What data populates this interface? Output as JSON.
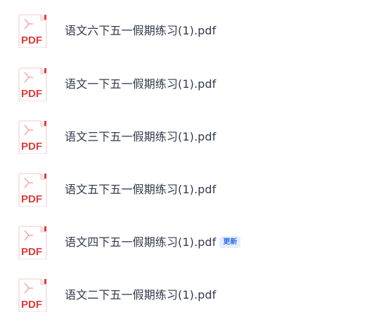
{
  "files": [
    {
      "name": "语文六下五一假期练习(1).pdf",
      "icon": "pdf-file-icon",
      "icon_text": "PDF",
      "badge": ""
    },
    {
      "name": "语文一下五一假期练习(1).pdf",
      "icon": "pdf-file-icon",
      "icon_text": "PDF",
      "badge": ""
    },
    {
      "name": "语文三下五一假期练习(1).pdf",
      "icon": "pdf-file-icon",
      "icon_text": "PDF",
      "badge": ""
    },
    {
      "name": "语文五下五一假期练习(1).pdf",
      "icon": "pdf-file-icon",
      "icon_text": "PDF",
      "badge": ""
    },
    {
      "name": "语文四下五一假期练习(1).pdf",
      "icon": "pdf-file-icon",
      "icon_text": "PDF",
      "badge": "更新"
    },
    {
      "name": "语文二下五一假期练习(1).pdf",
      "icon": "pdf-file-icon",
      "icon_text": "PDF",
      "badge": ""
    }
  ],
  "colors": {
    "pdf_red": "#e03b3b",
    "badge_bg": "#e6efff",
    "badge_text": "#2f6fe4",
    "text": "#333a4d"
  }
}
